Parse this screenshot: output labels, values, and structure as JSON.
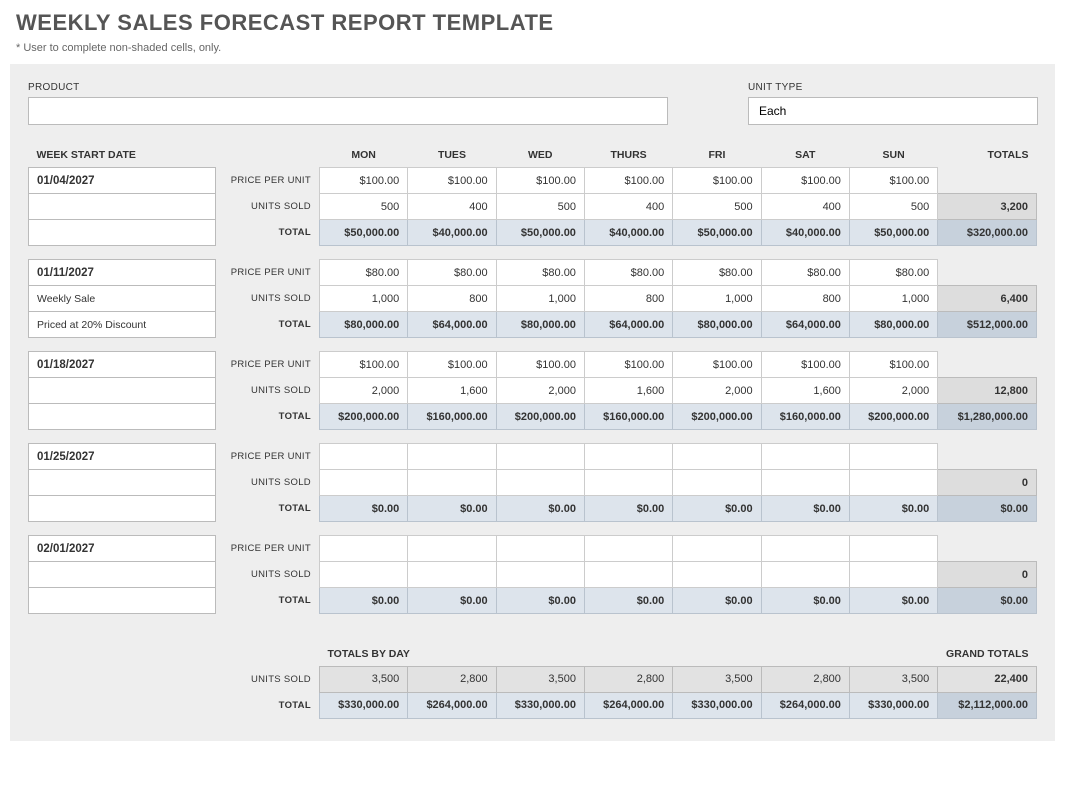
{
  "header": {
    "title": "WEEKLY SALES FORECAST REPORT TEMPLATE",
    "subtitle": "* User to complete non-shaded cells, only."
  },
  "fields": {
    "product_label": "PRODUCT",
    "product_value": "",
    "unit_type_label": "UNIT TYPE",
    "unit_type_value": "Each"
  },
  "columns": {
    "week_start_label": "WEEK START DATE",
    "days": [
      "MON",
      "TUES",
      "WED",
      "THURS",
      "FRI",
      "SAT",
      "SUN"
    ],
    "totals_label": "TOTALS"
  },
  "row_labels": {
    "price": "PRICE PER UNIT",
    "units": "UNITS SOLD",
    "total": "TOTAL"
  },
  "weeks": [
    {
      "date": "01/04/2027",
      "notes": [
        "",
        ""
      ],
      "price": [
        "$100.00",
        "$100.00",
        "$100.00",
        "$100.00",
        "$100.00",
        "$100.00",
        "$100.00",
        ""
      ],
      "units": [
        "500",
        "400",
        "500",
        "400",
        "500",
        "400",
        "500",
        "3,200"
      ],
      "total": [
        "$50,000.00",
        "$40,000.00",
        "$50,000.00",
        "$40,000.00",
        "$50,000.00",
        "$40,000.00",
        "$50,000.00",
        "$320,000.00"
      ]
    },
    {
      "date": "01/11/2027",
      "notes": [
        "Weekly Sale",
        "Priced at 20% Discount"
      ],
      "price": [
        "$80.00",
        "$80.00",
        "$80.00",
        "$80.00",
        "$80.00",
        "$80.00",
        "$80.00",
        ""
      ],
      "units": [
        "1,000",
        "800",
        "1,000",
        "800",
        "1,000",
        "800",
        "1,000",
        "6,400"
      ],
      "total": [
        "$80,000.00",
        "$64,000.00",
        "$80,000.00",
        "$64,000.00",
        "$80,000.00",
        "$64,000.00",
        "$80,000.00",
        "$512,000.00"
      ]
    },
    {
      "date": "01/18/2027",
      "notes": [
        "",
        ""
      ],
      "price": [
        "$100.00",
        "$100.00",
        "$100.00",
        "$100.00",
        "$100.00",
        "$100.00",
        "$100.00",
        ""
      ],
      "units": [
        "2,000",
        "1,600",
        "2,000",
        "1,600",
        "2,000",
        "1,600",
        "2,000",
        "12,800"
      ],
      "total": [
        "$200,000.00",
        "$160,000.00",
        "$200,000.00",
        "$160,000.00",
        "$200,000.00",
        "$160,000.00",
        "$200,000.00",
        "$1,280,000.00"
      ]
    },
    {
      "date": "01/25/2027",
      "notes": [
        "",
        ""
      ],
      "price": [
        "",
        "",
        "",
        "",
        "",
        "",
        "",
        ""
      ],
      "units": [
        "",
        "",
        "",
        "",
        "",
        "",
        "",
        "0"
      ],
      "total": [
        "$0.00",
        "$0.00",
        "$0.00",
        "$0.00",
        "$0.00",
        "$0.00",
        "$0.00",
        "$0.00"
      ]
    },
    {
      "date": "02/01/2027",
      "notes": [
        "",
        ""
      ],
      "price": [
        "",
        "",
        "",
        "",
        "",
        "",
        "",
        ""
      ],
      "units": [
        "",
        "",
        "",
        "",
        "",
        "",
        "",
        "0"
      ],
      "total": [
        "$0.00",
        "$0.00",
        "$0.00",
        "$0.00",
        "$0.00",
        "$0.00",
        "$0.00",
        "$0.00"
      ]
    }
  ],
  "summary": {
    "byday_label": "TOTALS BY DAY",
    "grand_label": "GRAND TOTALS",
    "units": [
      "3,500",
      "2,800",
      "3,500",
      "2,800",
      "3,500",
      "2,800",
      "3,500",
      "22,400"
    ],
    "total": [
      "$330,000.00",
      "$264,000.00",
      "$330,000.00",
      "$264,000.00",
      "$330,000.00",
      "$264,000.00",
      "$330,000.00",
      "$2,112,000.00"
    ]
  }
}
